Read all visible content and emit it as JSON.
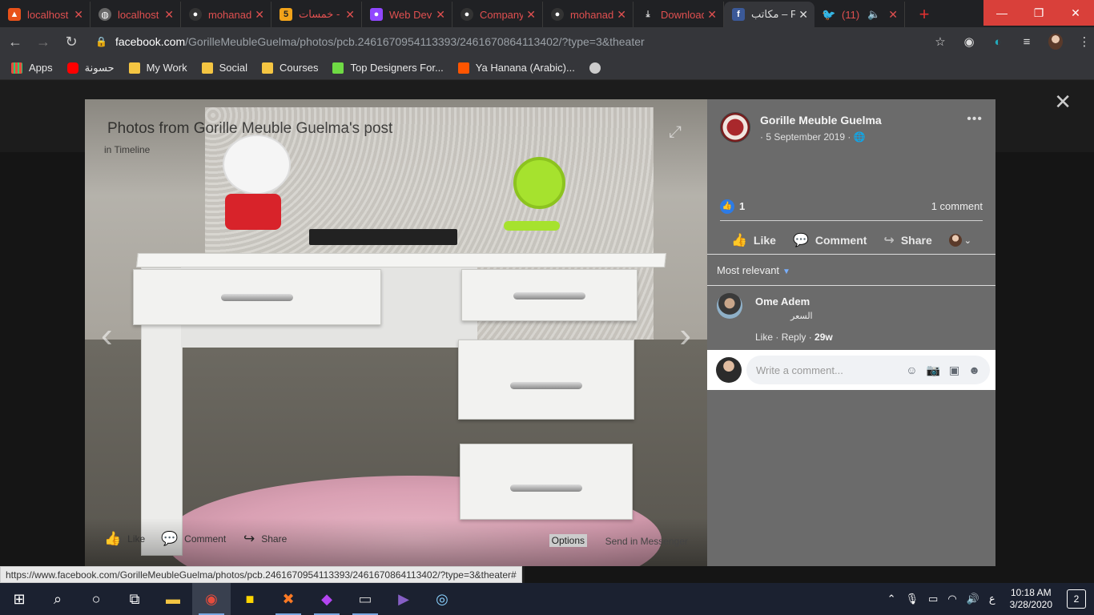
{
  "browser": {
    "tabs": [
      {
        "label": "localhost",
        "favicon": "xampp-icon",
        "color": "#e8521a"
      },
      {
        "label": "localhost",
        "favicon": "globe-icon",
        "color": "#888888"
      },
      {
        "label": "mohanad",
        "favicon": "github-icon",
        "color": "#444444"
      },
      {
        "label": "خمسات -",
        "favicon": "khamsat-icon",
        "color": "#f2a31a"
      },
      {
        "label": "Web Dev",
        "favicon": "twitch-icon",
        "color": "#9147ff"
      },
      {
        "label": "Company",
        "favicon": "github-icon",
        "color": "#444444"
      },
      {
        "label": "mohanad",
        "favicon": "github-icon",
        "color": "#444444"
      },
      {
        "label": "Downloads",
        "favicon": "download-icon",
        "color": "#bbbbbb"
      },
      {
        "label": "مكاتب – F",
        "favicon": "facebook-icon",
        "color": "#3b5998",
        "active": true
      },
      {
        "label": "(11) ",
        "favicon": "twitter-icon",
        "color": "#1da1f2"
      }
    ],
    "url_host": "facebook.com",
    "url_path": "/GorilleMeubleGuelma/photos/pcb.2461670954113393/2461670864113402/?type=3&theater"
  },
  "bookmarks": [
    {
      "label": "Apps",
      "icon": "apps-grid-icon",
      "color": "#e74c3c"
    },
    {
      "label": "حسونة",
      "icon": "youtube-icon",
      "color": "#ff0000"
    },
    {
      "label": "My Work",
      "icon": "folder-icon",
      "color": "#f4c542"
    },
    {
      "label": "Social",
      "icon": "folder-icon",
      "color": "#f4c542"
    },
    {
      "label": "Courses",
      "icon": "folder-icon",
      "color": "#f4c542"
    },
    {
      "label": "Top Designers For...",
      "icon": "upwork-icon",
      "color": "#6fda44"
    },
    {
      "label": "Ya Hanana (Arabic)...",
      "icon": "soundcloud-icon",
      "color": "#ff5500"
    },
    {
      "label": "",
      "icon": "globe-icon",
      "color": "#cccccc"
    }
  ],
  "photo": {
    "title": "Photos from Gorille Meuble Guelma's post",
    "subtitle": "in Timeline",
    "actions": {
      "like": "Like",
      "comment": "Comment",
      "share": "Share",
      "options": "Options",
      "send": "Send in Messenger"
    }
  },
  "post": {
    "page_name": "Gorille Meuble Guelma",
    "date": "· 5 September 2019 ·",
    "reaction_count": "1",
    "comment_count": "1 comment",
    "actions": {
      "like": "Like",
      "comment": "Comment",
      "share": "Share"
    },
    "sort_label": "Most relevant",
    "comment": {
      "author": "Ome Adem",
      "text": "السعر",
      "like": "Like",
      "reply": "Reply",
      "age": "29w"
    },
    "write_placeholder": "Write a comment..."
  },
  "status_url": "https://www.facebook.com/GorilleMeubleGuelma/photos/pcb.2461670954113393/2461670864113402/?type=3&theater#",
  "taskbar": {
    "time": "10:18 AM",
    "date": "3/28/2020",
    "lang": "ع",
    "notifications": "2"
  }
}
